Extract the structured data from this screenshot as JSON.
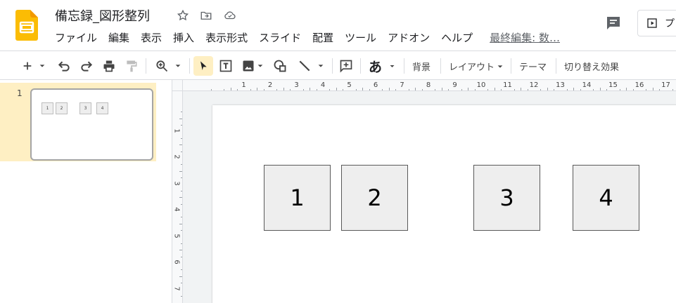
{
  "header": {
    "title": "備忘録_図形整列",
    "menu": [
      "ファイル",
      "編集",
      "表示",
      "挿入",
      "表示形式",
      "スライド",
      "配置",
      "ツール",
      "アドオン",
      "ヘルプ"
    ],
    "last_edit": "最終編集: 数…",
    "present_label": "プ",
    "brand_color": "#fbbc04"
  },
  "toolbar": {
    "background": "背景",
    "layout": "レイアウト",
    "theme": "テーマ",
    "transition": "切り替え効果",
    "input_glyph": "あ"
  },
  "filmstrip": {
    "slides": [
      {
        "number": "1",
        "thumb_labels": [
          "1",
          "2",
          "3",
          "4"
        ]
      }
    ]
  },
  "ruler": {
    "h_labels": [
      "1",
      "2",
      "3",
      "4",
      "5",
      "6",
      "7",
      "8",
      "9",
      "10",
      "11",
      "12",
      "13",
      "14",
      "15",
      "16",
      "17"
    ],
    "v_labels": [
      "1",
      "2",
      "3",
      "4",
      "5",
      "6",
      "7"
    ]
  },
  "slide": {
    "shapes": [
      "1",
      "2",
      "3",
      "4"
    ]
  }
}
